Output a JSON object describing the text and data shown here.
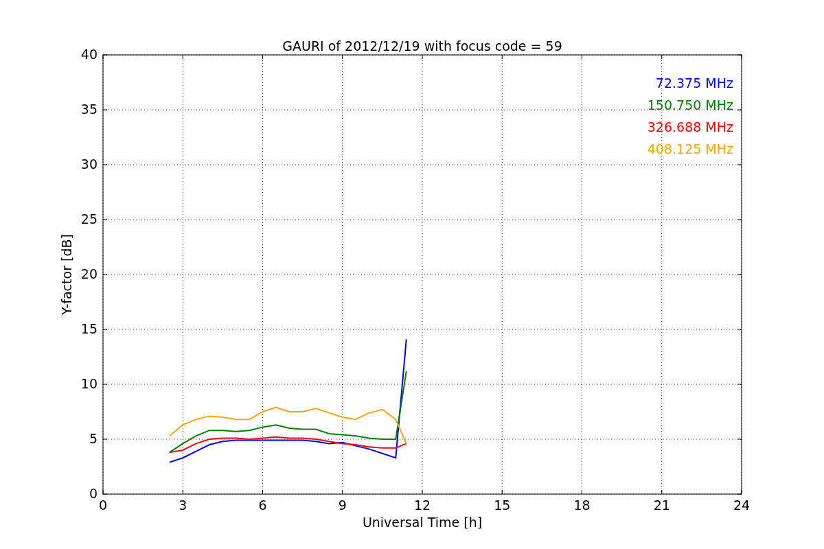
{
  "figure": {
    "chart_data": {
      "type": "line",
      "title": "GAURI of 2012/12/19 with focus code = 59",
      "xlabel": "Universal Time [h]",
      "ylabel": "Y-factor [dB]",
      "x": [
        2.5,
        3,
        3.5,
        4,
        4.5,
        5,
        5.5,
        6,
        6.5,
        7,
        7.5,
        8,
        8.5,
        9,
        9.5,
        10,
        10.5,
        11,
        11.4
      ],
      "series": [
        {
          "name": "72.375 MHz",
          "color": "#0000ff",
          "values": [
            2.9,
            3.3,
            3.9,
            4.5,
            4.8,
            4.9,
            4.9,
            4.9,
            4.9,
            4.9,
            4.9,
            4.8,
            4.6,
            4.7,
            4.4,
            4.1,
            3.7,
            3.3,
            14.1
          ]
        },
        {
          "name": "150.750 MHz",
          "color": "#008000",
          "values": [
            3.8,
            4.6,
            5.3,
            5.8,
            5.8,
            5.7,
            5.8,
            6.1,
            6.3,
            6.0,
            5.9,
            5.9,
            5.5,
            5.4,
            5.3,
            5.1,
            5.0,
            5.0,
            11.2
          ]
        },
        {
          "name": "326.688 MHz",
          "color": "#ff0000",
          "values": [
            3.8,
            4.0,
            4.6,
            5.0,
            5.1,
            5.1,
            5.0,
            5.1,
            5.2,
            5.1,
            5.1,
            5.0,
            4.8,
            4.6,
            4.5,
            4.3,
            4.2,
            4.2,
            4.6
          ]
        },
        {
          "name": "408.125 MHz",
          "color": "#ffa500",
          "values": [
            5.3,
            6.3,
            6.8,
            7.1,
            7.0,
            6.8,
            6.8,
            7.5,
            7.9,
            7.5,
            7.5,
            7.8,
            7.4,
            7.0,
            6.8,
            7.4,
            7.7,
            6.8,
            4.6
          ]
        }
      ],
      "grid": true,
      "xlim": [
        0,
        24
      ],
      "ylim": [
        0,
        40
      ],
      "xticks": [
        0,
        3,
        6,
        9,
        12,
        15,
        18,
        21,
        24
      ],
      "yticks": [
        0,
        5,
        10,
        15,
        20,
        25,
        30,
        35,
        40
      ]
    }
  }
}
